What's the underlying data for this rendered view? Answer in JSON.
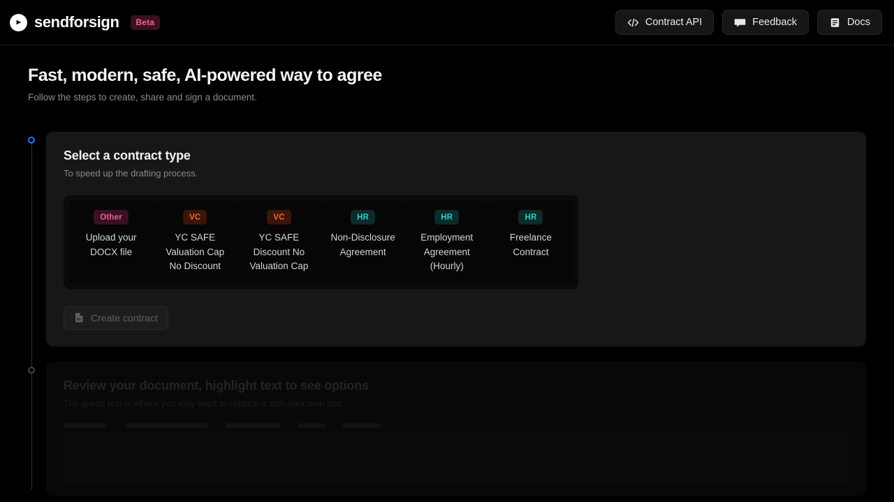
{
  "header": {
    "brand_name": "sendforsign",
    "beta_label": "Beta",
    "logo_icon": "play-circle-icon",
    "actions": [
      {
        "label": "Contract API",
        "icon": "code-brackets-icon"
      },
      {
        "label": "Feedback",
        "icon": "chat-bubble-icon"
      },
      {
        "label": "Docs",
        "icon": "book-icon"
      }
    ]
  },
  "page": {
    "title": "Fast, modern, safe, AI-powered way to agree",
    "subtitle": "Follow the steps to create, share and sign a document."
  },
  "steps": [
    {
      "state": "active",
      "title": "Select a contract type",
      "subtitle": "To speed up the drafting process.",
      "contract_types": [
        {
          "tag": "Other",
          "tag_kind": "other",
          "label": "Upload your\nDOCX file"
        },
        {
          "tag": "VC",
          "tag_kind": "vc",
          "label": "YC SAFE\nValuation Cap\nNo Discount"
        },
        {
          "tag": "VC",
          "tag_kind": "vc",
          "label": "YC SAFE\nDiscount No\nValuation Cap"
        },
        {
          "tag": "HR",
          "tag_kind": "hr",
          "label": "Non-Disclosure\nAgreement"
        },
        {
          "tag": "HR",
          "tag_kind": "hr",
          "label": "Employment\nAgreement\n(Hourly)"
        },
        {
          "tag": "HR",
          "tag_kind": "hr",
          "label": "Freelance\nContract"
        }
      ],
      "create_button": {
        "label": "Create contract",
        "icon": "document-icon",
        "disabled": true
      }
    },
    {
      "state": "inactive",
      "title": "Review your document, highlight text to see options",
      "subtitle": "The green text is where you may want to replace it with your own text."
    }
  ],
  "colors": {
    "page_background": "#000000",
    "card_background": "#171717",
    "panel_background": "#0a0a0a",
    "accent_active_step": "#2f6fea",
    "tag_other": "#f05f9a",
    "tag_vc": "#f06a36",
    "tag_hr": "#2ecfc4",
    "beta_badge": "#f75f9a"
  }
}
